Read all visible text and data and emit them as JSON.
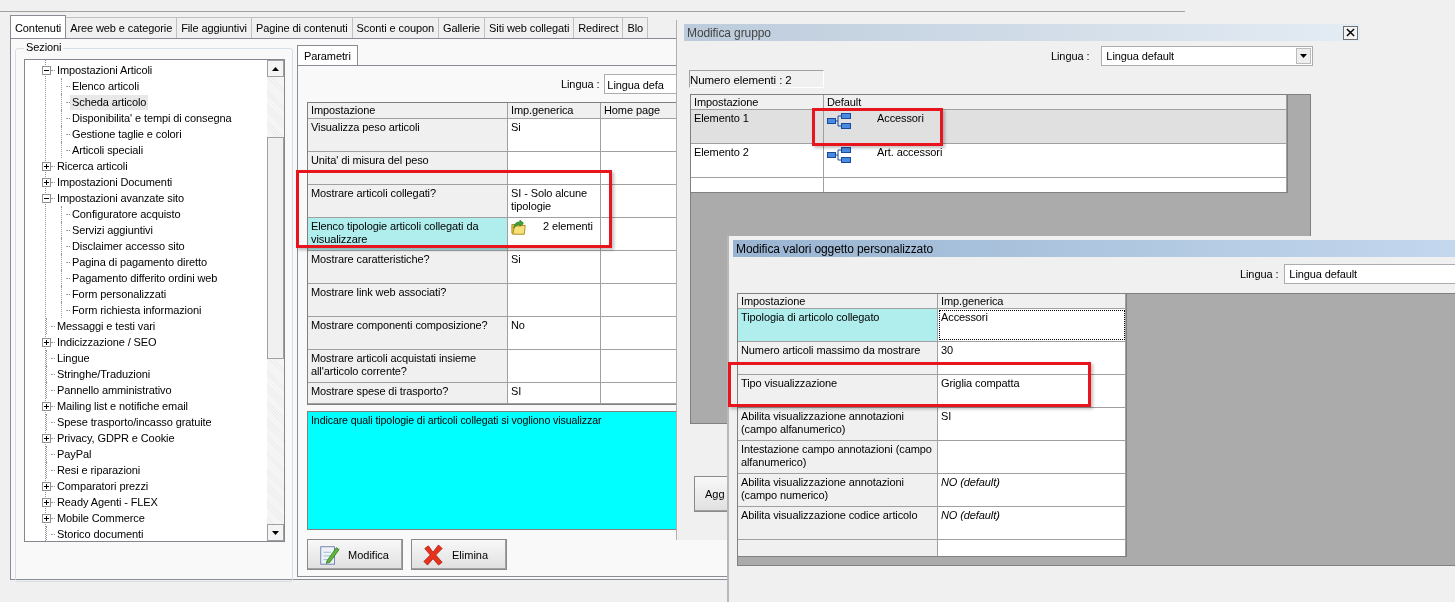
{
  "main_window": {
    "tabs": [
      {
        "label": "Contenuti",
        "selected": true
      },
      {
        "label": "Aree web e categorie",
        "selected": false
      },
      {
        "label": "File aggiuntivi",
        "selected": false
      },
      {
        "label": "Pagine di contenuti",
        "selected": false
      },
      {
        "label": "Sconti e coupon",
        "selected": false
      },
      {
        "label": "Gallerie",
        "selected": false
      },
      {
        "label": "Siti web collegati",
        "selected": false
      },
      {
        "label": "Redirect",
        "selected": false
      },
      {
        "label": "Blo",
        "selected": false
      }
    ],
    "sections": {
      "title": "Sezioni",
      "tree": [
        {
          "label": "Impostazioni Articoli",
          "expanded": true,
          "selected": false,
          "children": [
            {
              "label": "Elenco articoli",
              "selected": false
            },
            {
              "label": "Scheda articolo",
              "selected": true
            },
            {
              "label": "Disponibilita' e tempi di consegna",
              "selected": false
            },
            {
              "label": "Gestione taglie e colori",
              "selected": false
            },
            {
              "label": "Articoli speciali",
              "selected": false
            }
          ]
        },
        {
          "label": "Ricerca articoli",
          "expanded": false,
          "selected": false
        },
        {
          "label": "Impostazioni Documenti",
          "expanded": false,
          "selected": false
        },
        {
          "label": "Impostazioni avanzate sito",
          "expanded": true,
          "selected": false,
          "children": [
            {
              "label": "Configuratore acquisto",
              "selected": false
            },
            {
              "label": "Servizi aggiuntivi",
              "selected": false
            },
            {
              "label": "Disclaimer accesso sito",
              "selected": false
            },
            {
              "label": "Pagina di pagamento diretto",
              "selected": false
            },
            {
              "label": "Pagamento differito ordini web",
              "selected": false
            },
            {
              "label": "Form personalizzati",
              "selected": false
            },
            {
              "label": "Form richiesta informazioni",
              "selected": false
            }
          ]
        },
        {
          "label": "Messaggi e testi vari",
          "selected": false
        },
        {
          "label": "Indicizzazione / SEO",
          "expanded": false,
          "selected": false
        },
        {
          "label": "Lingue",
          "selected": false
        },
        {
          "label": "Stringhe/Traduzioni",
          "selected": false
        },
        {
          "label": "Pannello amministrativo",
          "selected": false
        },
        {
          "label": "Mailing list e notifiche email",
          "expanded": false,
          "selected": false
        },
        {
          "label": "Spese trasporto/incasso gratuite",
          "selected": false
        },
        {
          "label": "Privacy, GDPR e Cookie",
          "expanded": false,
          "selected": false
        },
        {
          "label": "PayPal",
          "selected": false
        },
        {
          "label": "Resi e riparazioni",
          "selected": false
        },
        {
          "label": "Comparatori prezzi",
          "expanded": false,
          "selected": false
        },
        {
          "label": "Ready Agenti - FLEX",
          "expanded": false,
          "selected": false
        },
        {
          "label": "Mobile Commerce",
          "expanded": false,
          "selected": false
        },
        {
          "label": "Storico documenti",
          "selected": false
        }
      ]
    },
    "parameters": {
      "tab": {
        "label": "Parametri",
        "selected": true
      },
      "language": {
        "label": "Lingua :",
        "value": "Lingua defa"
      },
      "columns": [
        "Impostazione",
        "Imp.generica",
        "Home page"
      ],
      "rows": [
        {
          "setting": "Visualizza peso articoli",
          "kind": "text",
          "value": "Si",
          "selected": false
        },
        {
          "setting": "Unita' di misura del peso",
          "kind": "text",
          "selected": false
        },
        {
          "setting": "Mostrare articoli collegati?",
          "kind": "text",
          "value": "SI - Solo alcune tipologie",
          "selected": false
        },
        {
          "setting": "Elenco tipologie articoli collegati da visualizzare",
          "kind": "group",
          "value": "2 elementi",
          "selected": true
        },
        {
          "setting": "Mostrare caratteristiche?",
          "kind": "text",
          "value": "Si",
          "selected": false
        },
        {
          "setting": "Mostrare link web associati?",
          "kind": "text",
          "selected": false
        },
        {
          "setting": "Mostrare componenti composizione?",
          "kind": "text",
          "value": "No",
          "selected": false
        },
        {
          "setting": "Mostrare articoli acquistati insieme all'articolo corrente?",
          "kind": "text",
          "selected": false
        },
        {
          "setting": "Mostrare spese di trasporto?",
          "kind": "text",
          "value": "SI",
          "selected": false
        }
      ],
      "description": "Indicare quali tipologie di articoli collegati si vogliono visualizzar",
      "buttons": [
        {
          "label": "Modifica",
          "kind": "edit"
        },
        {
          "label": "Elimina",
          "kind": "delete"
        }
      ]
    }
  },
  "group_dialog": {
    "title": "Modifica gruppo",
    "language": {
      "label": "Lingua :",
      "value": "Lingua default"
    },
    "count": "Numero elementi : 2",
    "columns": [
      "Impostazione",
      "Default"
    ],
    "rows": [
      {
        "setting": "Elemento 1",
        "value": "Accessori",
        "selected": true
      },
      {
        "setting": "Elemento 2",
        "value": "Art. accessori",
        "selected": false
      }
    ],
    "buttons": [
      {
        "label": "Agg"
      }
    ]
  },
  "values_dialog": {
    "title": "Modifica valori oggetto personalizzato",
    "language": {
      "label": "Lingua :",
      "value": "Lingua default"
    },
    "columns": [
      "Impostazione",
      "Imp.generica"
    ],
    "rows": [
      {
        "setting": "Tipologia di articolo collegato",
        "value": "Accessori",
        "inherited": false,
        "selected": true
      },
      {
        "setting": "Numero articoli massimo da mostrare",
        "value": "30",
        "inherited": false,
        "selected": false
      },
      {
        "setting": "Tipo visualizzazione",
        "value": "Griglia compatta",
        "inherited": false,
        "selected": false
      },
      {
        "setting": "Abilita visualizzazione annotazioni (campo alfanumerico)",
        "value": "SI",
        "inherited": false,
        "selected": false
      },
      {
        "setting": "Intestazione campo annotazioni (campo alfanumerico)",
        "selected": false
      },
      {
        "setting": "Abilita visualizzazione annotazioni (campo numerico)",
        "value": "NO (default)",
        "inherited": true,
        "selected": false
      },
      {
        "setting": "Abilita visualizzazione codice articolo",
        "value": "NO (default)",
        "inherited": true,
        "selected": false
      }
    ]
  }
}
